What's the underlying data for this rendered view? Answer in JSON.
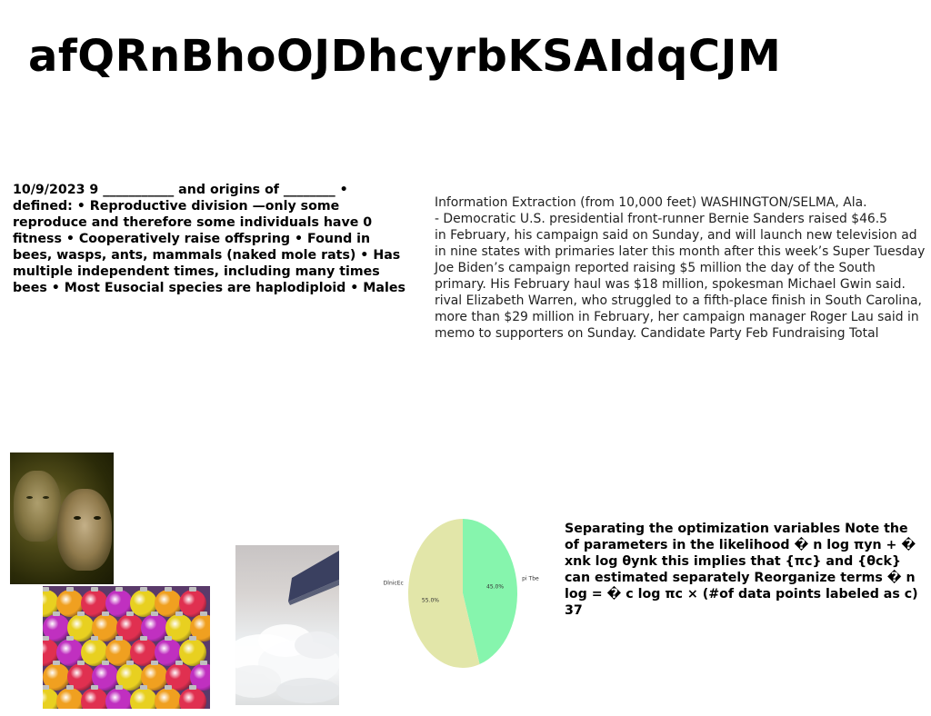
{
  "page": {
    "title": "afQRnBhoOJDhcyrbKSAIdqCJM"
  },
  "left_block": {
    "text": "10/9/2023 9 ___________ and origins of ________ • defined: • Reproductive division —only some reproduce and therefore some individuals have 0 fitness • Cooperatively raise offspring • Found in bees, wasps, ants, mammals (naked mole rats) • Has multiple independent times, including many times bees • Most Eusocial species are haplodiploid • Males"
  },
  "news_block": {
    "lines": [
      "Information Extraction (from 10,000 feet) WASHINGTON/SELMA, Ala.",
      "- Democratic U.S. presidential front-runner Bernie Sanders raised $46.5",
      "in February, his campaign said on Sunday, and will launch new television ad",
      "in nine states with primaries later this month after this week’s Super Tuesday",
      "Joe Biden’s campaign reported raising $5 million the day of the South",
      "primary. His February haul was $18 million, spokesman Michael Gwin said.",
      "rival Elizabeth Warren, who struggled to a fifth-place finish in South Carolina,",
      "more than $29 million in February, her campaign manager Roger Lau said in",
      "memo to supporters on Sunday. Candidate Party Feb Fundraising Total"
    ]
  },
  "right_block": {
    "text": "Separating the optimization variables Note the of parameters in the likelihood � n log πyn + � xnk log θynk this implies that {πc} and {θck} can estimated separately Reorganize terms � n log = � c log πc × (#of data points labeled as c) 37"
  },
  "chart_data": {
    "type": "pie",
    "title": "",
    "slices": [
      {
        "label": "pi Tbe",
        "value": 45.0,
        "pct_label": "45.0%",
        "color": "#86f5ad"
      },
      {
        "label": "DlnicEc",
        "value": 55.0,
        "pct_label": "55.0%",
        "color": "#e2e6a9"
      }
    ],
    "start_angle_deg": 90,
    "direction": "clockwise"
  },
  "images": {
    "faces_photo": "two-faces-dark-photo",
    "ornaments_photo": "colorful-christmas-ornaments-photo",
    "clouds_photo": "airplane-wing-over-clouds-photo"
  }
}
